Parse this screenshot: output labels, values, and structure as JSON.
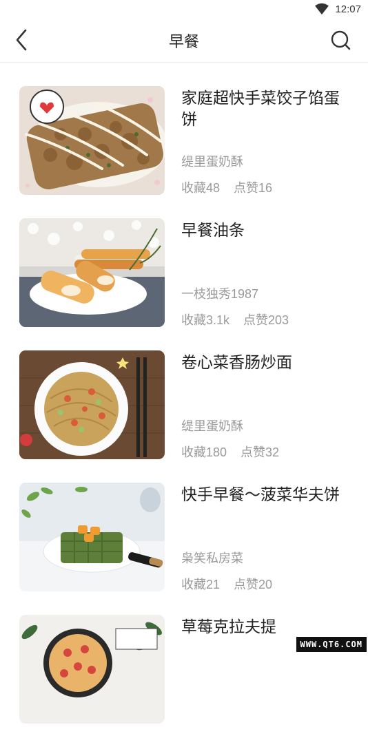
{
  "status": {
    "time": "12:07"
  },
  "header": {
    "title": "早餐"
  },
  "recipes": [
    {
      "title": "家庭超快手菜饺子馅蛋饼",
      "author": "缇里蛋奶酥",
      "favorites": "收藏48",
      "likes": "点赞16"
    },
    {
      "title": "早餐油条",
      "author": "一枝独秀1987",
      "favorites": "收藏3.1k",
      "likes": "点赞203"
    },
    {
      "title": "卷心菜香肠炒面",
      "author": "缇里蛋奶酥",
      "favorites": "收藏180",
      "likes": "点赞32"
    },
    {
      "title": "快手早餐～菠菜华夫饼",
      "author": "枭笑私房菜",
      "favorites": "收藏21",
      "likes": "点赞20"
    },
    {
      "title": "草莓克拉夫提",
      "author": "",
      "favorites": "",
      "likes": ""
    }
  ],
  "watermark": "WWW.QT6.COM",
  "colors": {
    "text": "#222222",
    "secondary": "#9a9a9a",
    "divider": "#eeeeee"
  }
}
